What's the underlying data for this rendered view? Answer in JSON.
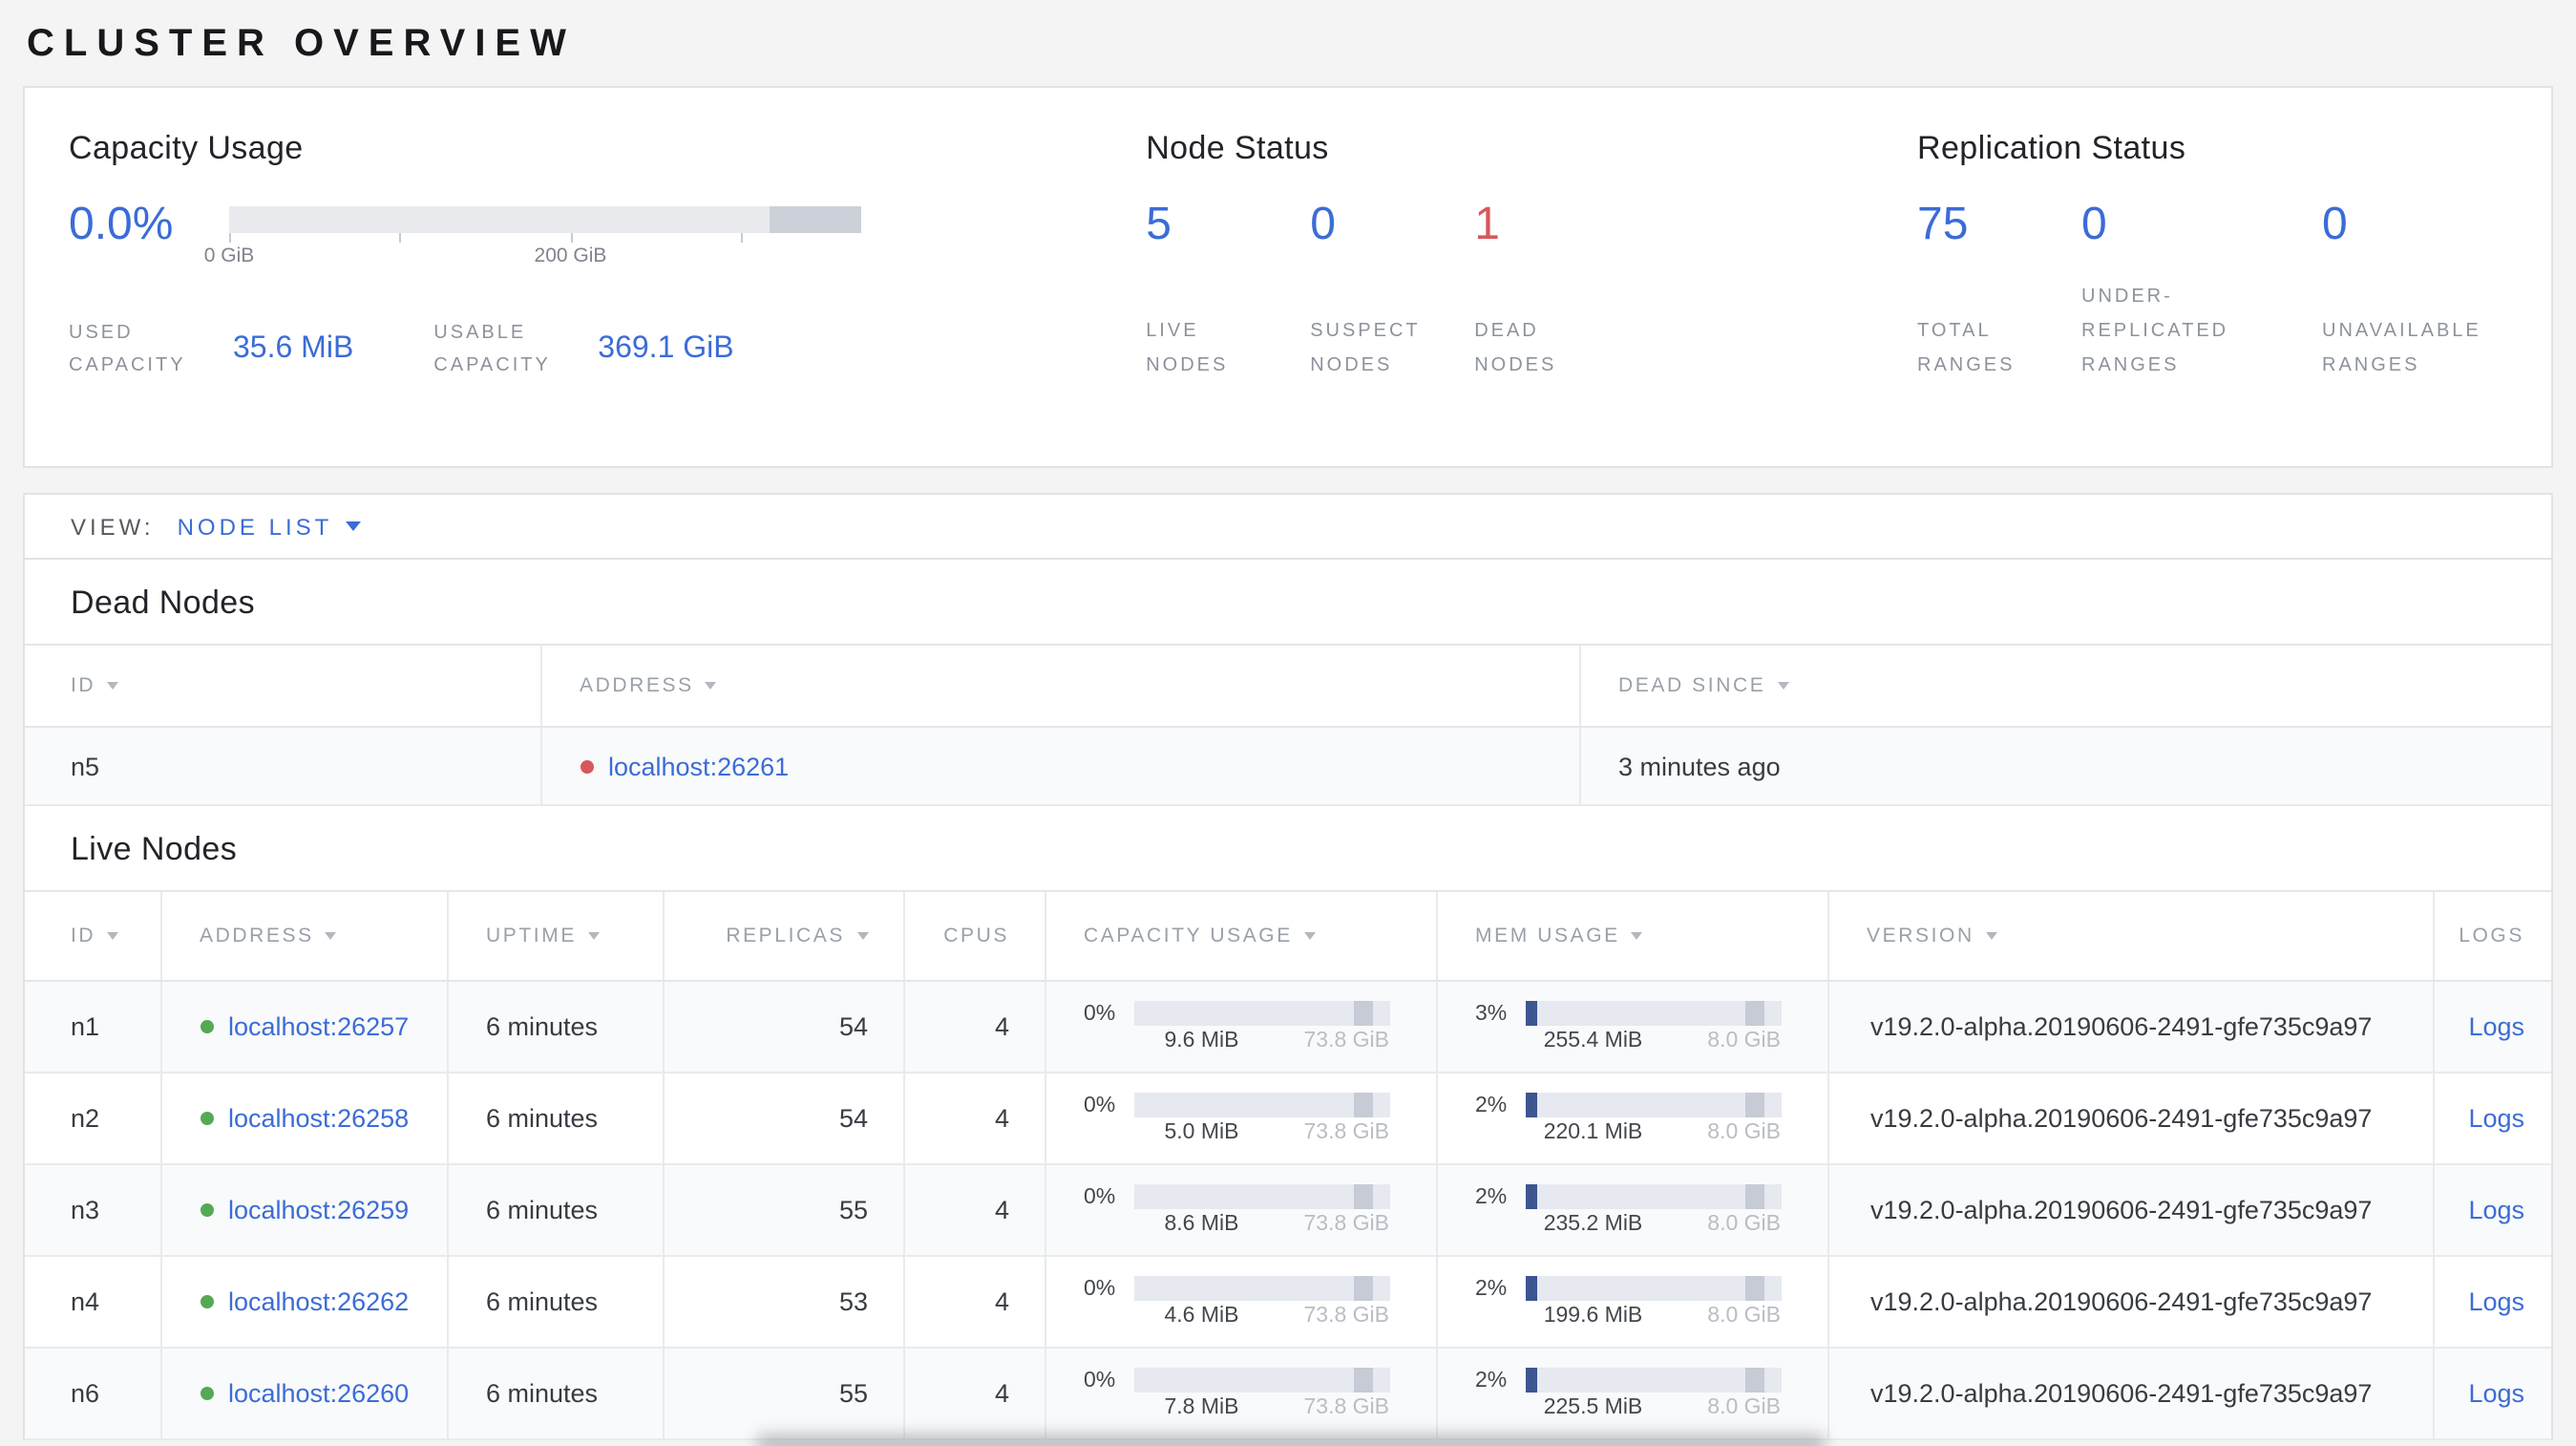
{
  "page": {
    "title": "CLUSTER OVERVIEW"
  },
  "colors": {
    "accent_blue": "#3b6cd7",
    "danger_red": "#d7585c",
    "live_green": "#55a954"
  },
  "summary": {
    "capacity": {
      "title": "Capacity Usage",
      "percent": "0.0%",
      "tick_labels": [
        "0 GiB",
        "200 GiB"
      ],
      "stats": [
        {
          "label": "USED CAPACITY",
          "value": "35.6 MiB"
        },
        {
          "label": "USABLE CAPACITY",
          "value": "369.1 GiB"
        }
      ]
    },
    "node_status": {
      "title": "Node Status",
      "stats": [
        {
          "value": "5",
          "label": "LIVE NODES",
          "tone": "blue"
        },
        {
          "value": "0",
          "label": "SUSPECT NODES",
          "tone": "blue"
        },
        {
          "value": "1",
          "label": "DEAD NODES",
          "tone": "red"
        }
      ]
    },
    "replication": {
      "title": "Replication Status",
      "stats": [
        {
          "value": "75",
          "label": "TOTAL RANGES",
          "tone": "blue"
        },
        {
          "value": "0",
          "label": "UNDER-REPLICATED RANGES",
          "tone": "blue"
        },
        {
          "value": "0",
          "label": "UNAVAILABLE RANGES",
          "tone": "blue"
        }
      ]
    }
  },
  "view_bar": {
    "label": "VIEW:",
    "selected": "NODE LIST"
  },
  "dead_nodes": {
    "title": "Dead Nodes",
    "headers": [
      "ID",
      "ADDRESS",
      "DEAD SINCE"
    ],
    "rows": [
      {
        "id": "n5",
        "address": "localhost:26261",
        "dead_since": "3 minutes ago"
      }
    ]
  },
  "live_nodes": {
    "title": "Live Nodes",
    "headers": [
      "ID",
      "ADDRESS",
      "UPTIME",
      "REPLICAS",
      "CPUS",
      "CAPACITY USAGE",
      "MEM USAGE",
      "VERSION",
      "LOGS"
    ],
    "rows": [
      {
        "id": "n1",
        "address": "localhost:26257",
        "uptime": "6 minutes",
        "replicas": "54",
        "cpus": "4",
        "capacity": {
          "percent": "0%",
          "used": "9.6 MiB",
          "total": "73.8 GiB"
        },
        "memory": {
          "percent": "3%",
          "used": "255.4 MiB",
          "total": "8.0 GiB"
        },
        "version": "v19.2.0-alpha.20190606-2491-gfe735c9a97",
        "logs_label": "Logs"
      },
      {
        "id": "n2",
        "address": "localhost:26258",
        "uptime": "6 minutes",
        "replicas": "54",
        "cpus": "4",
        "capacity": {
          "percent": "0%",
          "used": "5.0 MiB",
          "total": "73.8 GiB"
        },
        "memory": {
          "percent": "2%",
          "used": "220.1 MiB",
          "total": "8.0 GiB"
        },
        "version": "v19.2.0-alpha.20190606-2491-gfe735c9a97",
        "logs_label": "Logs"
      },
      {
        "id": "n3",
        "address": "localhost:26259",
        "uptime": "6 minutes",
        "replicas": "55",
        "cpus": "4",
        "capacity": {
          "percent": "0%",
          "used": "8.6 MiB",
          "total": "73.8 GiB"
        },
        "memory": {
          "percent": "2%",
          "used": "235.2 MiB",
          "total": "8.0 GiB"
        },
        "version": "v19.2.0-alpha.20190606-2491-gfe735c9a97",
        "logs_label": "Logs"
      },
      {
        "id": "n4",
        "address": "localhost:26262",
        "uptime": "6 minutes",
        "replicas": "53",
        "cpus": "4",
        "capacity": {
          "percent": "0%",
          "used": "4.6 MiB",
          "total": "73.8 GiB"
        },
        "memory": {
          "percent": "2%",
          "used": "199.6 MiB",
          "total": "8.0 GiB"
        },
        "version": "v19.2.0-alpha.20190606-2491-gfe735c9a97",
        "logs_label": "Logs"
      },
      {
        "id": "n6",
        "address": "localhost:26260",
        "uptime": "6 minutes",
        "replicas": "55",
        "cpus": "4",
        "capacity": {
          "percent": "0%",
          "used": "7.8 MiB",
          "total": "73.8 GiB"
        },
        "memory": {
          "percent": "2%",
          "used": "225.5 MiB",
          "total": "8.0 GiB"
        },
        "version": "v19.2.0-alpha.20190606-2491-gfe735c9a97",
        "logs_label": "Logs"
      }
    ]
  }
}
